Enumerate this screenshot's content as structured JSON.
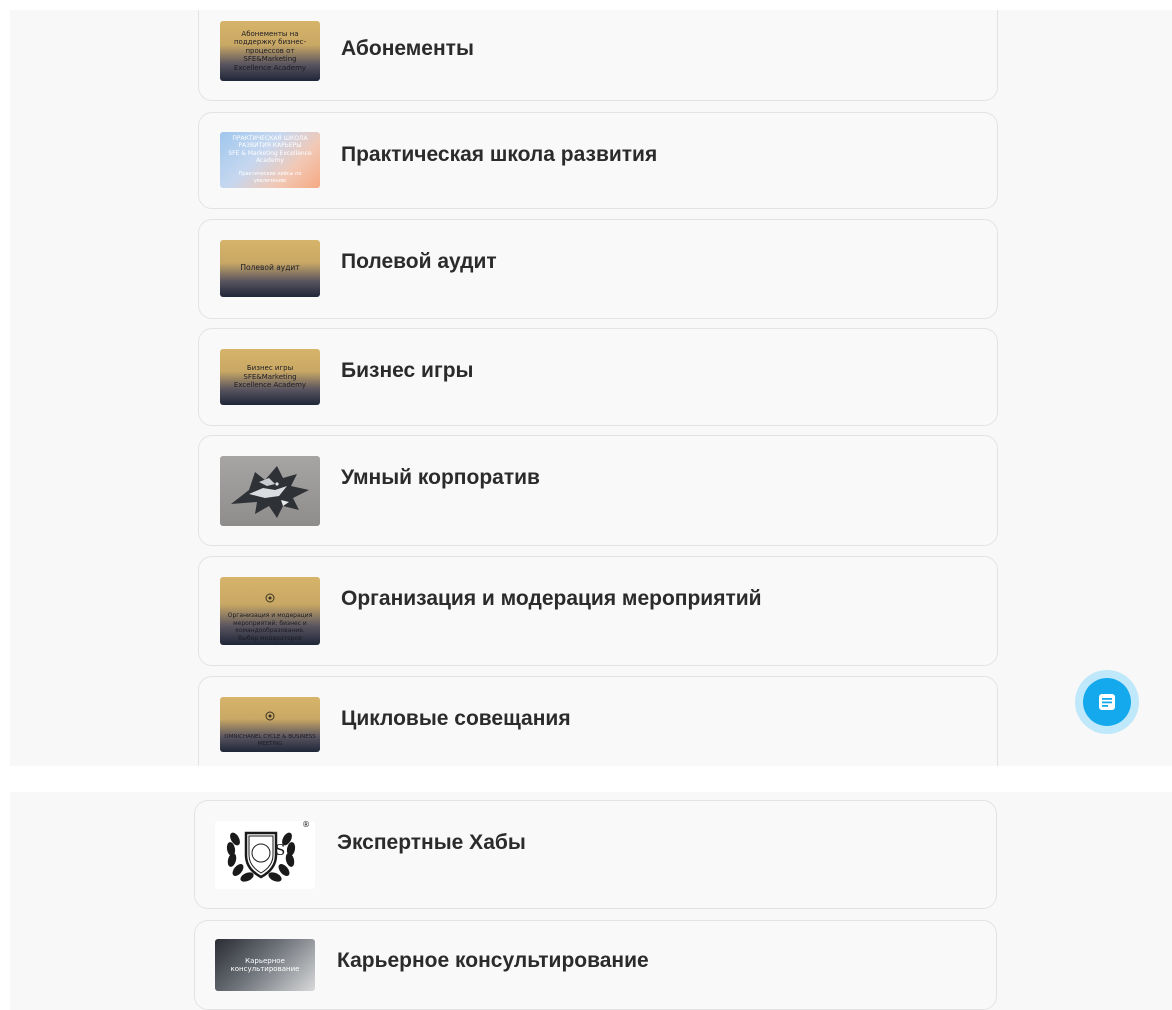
{
  "services_top": [
    {
      "title": "Абонементы",
      "thumb_lines": [
        "Абонементы на",
        "поддержку бизнес-",
        "процессов от",
        "SFE&Marketing",
        "Excellence Academy"
      ]
    },
    {
      "title": "Практическая школа развития",
      "thumb_lines": [
        "ПРАКТИЧЕСКАЯ ШКОЛА",
        "РАЗВИТИЯ КАРЬЕРЫ",
        "SFE & Marketing Excellence",
        "Academy",
        "Практические кейсы по увеличению"
      ]
    },
    {
      "title": "Полевой аудит",
      "thumb_lines": [
        "Полевой аудит"
      ]
    },
    {
      "title": "Бизнес игры",
      "thumb_lines": [
        "Бизнес игры",
        "SFE&Marketing",
        "Excellence Academy"
      ]
    },
    {
      "title": "Умный корпоратив",
      "thumb_lines": []
    },
    {
      "title": "Организация и модерация мероприятий",
      "thumb_lines": [
        "Организация и модерация",
        "мероприятий: бизнес и",
        "командообразование.",
        "Выбор модераторов"
      ]
    },
    {
      "title": "Цикловые совещания",
      "thumb_lines": [
        "OMNICHANEL CYCLE & BUSINESS",
        "MEETING"
      ]
    }
  ],
  "services_bottom": [
    {
      "title": "Экспертные Хабы",
      "thumb_lines": [
        "S",
        "®"
      ]
    },
    {
      "title": "Карьерное консультирование",
      "thumb_lines": [
        "Карьерное",
        "консультирование"
      ]
    }
  ],
  "fab": {
    "icon": "document-icon"
  },
  "colors": {
    "accent": "#14a9ec",
    "card_border": "#e3e3e3",
    "title": "#2b2b2b"
  }
}
